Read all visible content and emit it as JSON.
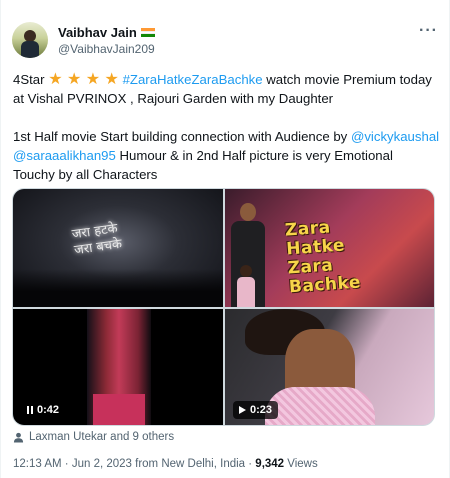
{
  "author": {
    "name": "Vaibhav Jain",
    "handle": "@VaibhavJain209",
    "flag_icon": "india-flag-icon"
  },
  "more_label": "···",
  "tweet": {
    "line1_prefix": "4Star ",
    "stars": "★ ★ ★ ★",
    "hashtag": "#ZaraHatkeZaraBachke",
    "line1_suffix": " watch movie Premium today",
    "line2": "at Vishal PVRINOX , Rajouri Garden with my Daughter",
    "line3_prefix": "1st Half movie Start building connection with Audience by ",
    "mention1": "@vickykaushal",
    "mention2": "@saraaalikhan95",
    "line4_suffix": " Humour  &  in 2nd Half picture is very Emotional",
    "line5": "Touchy by all Characters"
  },
  "media": {
    "screen_text": "जरा हटके\nजरा बचके",
    "poster_title": "Zara\nHatke\nZara\nBachke",
    "video1_duration": "0:42",
    "video2_duration": "0:23"
  },
  "engagement": {
    "liked_by": "Laxman Utekar and 9 others"
  },
  "meta": {
    "time": "12:13 AM",
    "sep1": " · ",
    "date": "Jun 2, 2023",
    "location": " from New Delhi, India",
    "sep2": " · ",
    "views_count": "9,342",
    "views_label": " Views"
  },
  "colors": {
    "link": "#1d9bf0",
    "secondary_text": "#536471",
    "star": "#f5a623"
  }
}
